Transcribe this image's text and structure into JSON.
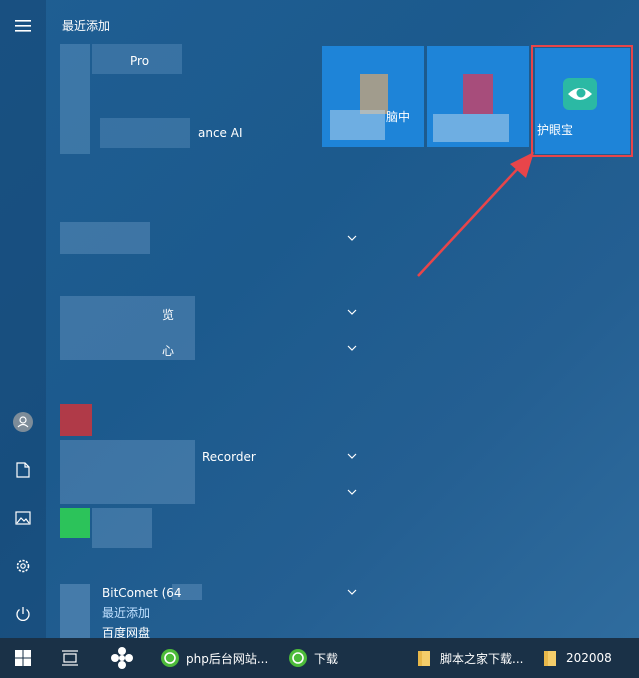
{
  "app_list": {
    "header": "最近添加",
    "items": [
      {
        "label": "Pro"
      },
      {
        "label": "ance AI"
      },
      {
        "label": "览"
      },
      {
        "label": "心"
      },
      {
        "label": "Recorder"
      },
      {
        "label": "BitComet (64",
        "sub": "最近添加"
      },
      {
        "label": "百度网盘"
      }
    ]
  },
  "tiles": [
    {
      "label": "脑中"
    },
    {
      "label": ""
    },
    {
      "label": "护眼宝"
    }
  ],
  "taskbar": {
    "items": [
      {
        "label": "php后台网站..."
      },
      {
        "label": "下载"
      },
      {
        "label": "脚本之家下载..."
      },
      {
        "label": "202008"
      }
    ]
  },
  "colors": {
    "highlight": "#e8454a",
    "tile": "#1e84d8",
    "taskbar": "#1a3147"
  }
}
